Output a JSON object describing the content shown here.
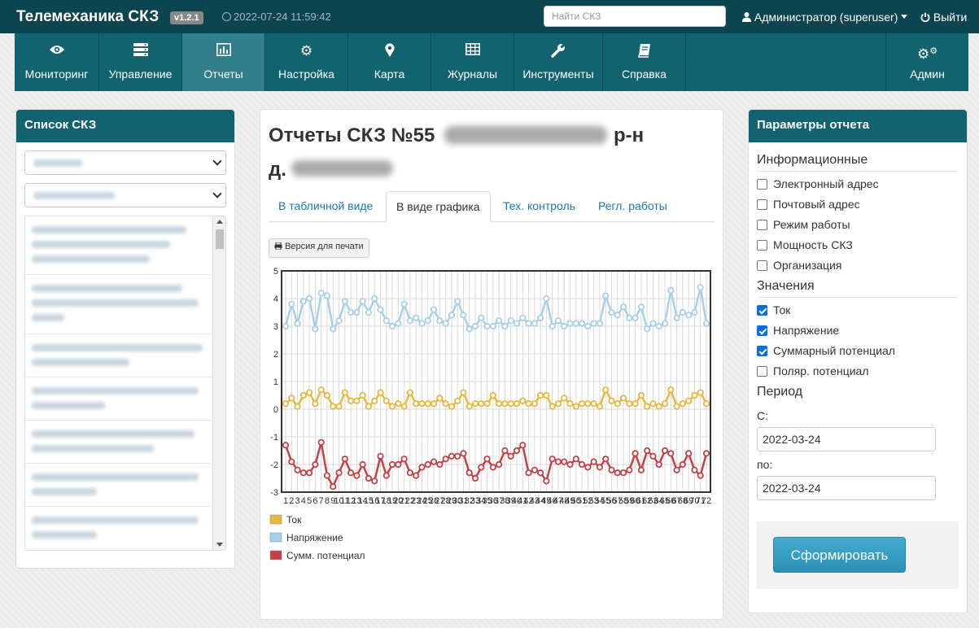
{
  "header": {
    "brand": "Телемеханика СКЗ",
    "version": "v1.2.1",
    "datetime": "2022-07-24 11:59:42",
    "search_placeholder": "Найти СКЗ",
    "user": "Администратор (superuser)",
    "logout": "Выйти"
  },
  "nav": {
    "items": [
      {
        "label": "Мониторинг",
        "icon": "eye-icon"
      },
      {
        "label": "Управление",
        "icon": "server-icon"
      },
      {
        "label": "Отчеты",
        "icon": "bar-chart-icon",
        "active": true
      },
      {
        "label": "Настройка",
        "icon": "gear-icon"
      },
      {
        "label": "Карта",
        "icon": "map-marker-icon"
      },
      {
        "label": "Журналы",
        "icon": "table-icon"
      },
      {
        "label": "Инструменты",
        "icon": "wrench-icon"
      },
      {
        "label": "Справка",
        "icon": "book-icon"
      },
      {
        "label": "Админ",
        "icon": "gears-icon"
      }
    ]
  },
  "left": {
    "title": "Список СКЗ"
  },
  "center": {
    "title_line1": "Отчеты СКЗ №55",
    "title_suffix": "р-н",
    "title_line2": "д.",
    "tabs": [
      "В табличной виде",
      "В виде графика",
      "Тех. контроль",
      "Регл. работы"
    ],
    "active_tab": 1,
    "print_label": "Версия для печати"
  },
  "chart_data": {
    "type": "line",
    "x": [
      1,
      2,
      3,
      4,
      5,
      6,
      7,
      8,
      9,
      10,
      11,
      12,
      13,
      14,
      15,
      16,
      17,
      18,
      19,
      20,
      21,
      22,
      23,
      24,
      25,
      26,
      27,
      28,
      29,
      30,
      31,
      32,
      33,
      34,
      35,
      36,
      37,
      38,
      39,
      40,
      41,
      42,
      43,
      44,
      45,
      46,
      47,
      48,
      49,
      50,
      51,
      52,
      53,
      54,
      55,
      56,
      57,
      58,
      59,
      60,
      61,
      62,
      63,
      64,
      65,
      66,
      67,
      68,
      69,
      70,
      71,
      72
    ],
    "ylim": [
      -3,
      5
    ],
    "yticks": [
      -3,
      -2,
      -1,
      0,
      1,
      2,
      3,
      4,
      5
    ],
    "grid": true,
    "legend_position": "bottom-left",
    "series": [
      {
        "name": "Ток",
        "color": "#e8b73d",
        "values": [
          0.2,
          0.4,
          0.1,
          0.5,
          0.6,
          0.2,
          0.7,
          0.5,
          0.1,
          0.1,
          0.6,
          0.3,
          0.3,
          0.5,
          0.1,
          0.3,
          0.6,
          0.3,
          0.1,
          0.2,
          0.1,
          0.6,
          0.2,
          0.2,
          0.2,
          0.2,
          0.4,
          0.2,
          0.1,
          0.3,
          0.6,
          0.1,
          0.2,
          0.2,
          0.2,
          0.5,
          0.2,
          0.2,
          0.2,
          0.2,
          0.3,
          0.2,
          0.2,
          0.5,
          0.5,
          0.1,
          0.2,
          0.4,
          0.2,
          0.1,
          0.2,
          0.2,
          0.2,
          0.1,
          0.7,
          0.3,
          0.2,
          0.4,
          0.2,
          0.2,
          0.5,
          0.1,
          0.2,
          0.1,
          0.2,
          0.7,
          0.1,
          0.2,
          0.3,
          0.5,
          0.6,
          0.2
        ]
      },
      {
        "name": "Напряжение",
        "color": "#a8d0e8",
        "values": [
          3.0,
          3.8,
          3.1,
          3.9,
          4.0,
          2.9,
          4.2,
          4.1,
          2.9,
          3.2,
          3.9,
          3.5,
          3.5,
          3.9,
          3.5,
          4.0,
          3.6,
          3.2,
          3.0,
          3.1,
          3.8,
          3.2,
          3.3,
          3.1,
          3.2,
          3.6,
          3.2,
          3.1,
          3.4,
          3.9,
          3.4,
          2.9,
          3.0,
          3.3,
          3.0,
          3.0,
          3.2,
          3.0,
          3.2,
          3.1,
          3.3,
          3.1,
          3.1,
          3.3,
          4.0,
          3.0,
          3.2,
          3.0,
          3.1,
          3.1,
          3.1,
          3.0,
          3.1,
          3.1,
          4.1,
          3.5,
          3.4,
          3.7,
          3.3,
          3.3,
          3.7,
          2.9,
          3.1,
          3.0,
          3.1,
          4.3,
          3.3,
          3.5,
          3.4,
          3.5,
          4.4,
          3.1
        ]
      },
      {
        "name": "Сумм. потенциал",
        "color": "#c94044",
        "values": [
          -1.3,
          -1.9,
          -2.2,
          -2.3,
          -2.3,
          -2.0,
          -1.2,
          -2.4,
          -2.8,
          -2.3,
          -1.8,
          -2.3,
          -2.4,
          -2.0,
          -2.5,
          -2.6,
          -1.7,
          -2.4,
          -2.0,
          -2.0,
          -1.8,
          -2.3,
          -2.4,
          -2.1,
          -2.0,
          -1.9,
          -2.0,
          -1.8,
          -1.7,
          -1.7,
          -1.6,
          -2.3,
          -2.5,
          -2.1,
          -1.8,
          -2.1,
          -2.0,
          -1.5,
          -1.7,
          -1.5,
          -1.3,
          -2.3,
          -2.2,
          -2.3,
          -2.6,
          -1.8,
          -1.9,
          -1.9,
          -2.0,
          -1.8,
          -2.0,
          -2.1,
          -1.9,
          -2.1,
          -1.8,
          -2.2,
          -2.3,
          -2.3,
          -2.2,
          -1.6,
          -2.2,
          -1.5,
          -1.7,
          -2.0,
          -1.5,
          -1.6,
          -2.2,
          -2.0,
          -1.6,
          -2.2,
          -2.4,
          -1.6
        ]
      }
    ]
  },
  "right": {
    "title": "Параметры отчета",
    "section_info": "Информационные",
    "info_items": [
      {
        "label": "Электронный адрес",
        "checked": false
      },
      {
        "label": "Почтовый адрес",
        "checked": false
      },
      {
        "label": "Режим работы",
        "checked": false
      },
      {
        "label": "Мощность СКЗ",
        "checked": false
      },
      {
        "label": "Организация",
        "checked": false
      }
    ],
    "section_values": "Значения",
    "value_items": [
      {
        "label": "Ток",
        "checked": true
      },
      {
        "label": "Напряжение",
        "checked": true
      },
      {
        "label": "Суммарный потенциал",
        "checked": true
      },
      {
        "label": "Поляр. потенциал",
        "checked": false
      }
    ],
    "section_period": "Период",
    "from_label": "С:",
    "from_value": "2022-03-24",
    "to_label": "по:",
    "to_value": "2022-03-24",
    "submit": "Сформировать"
  }
}
